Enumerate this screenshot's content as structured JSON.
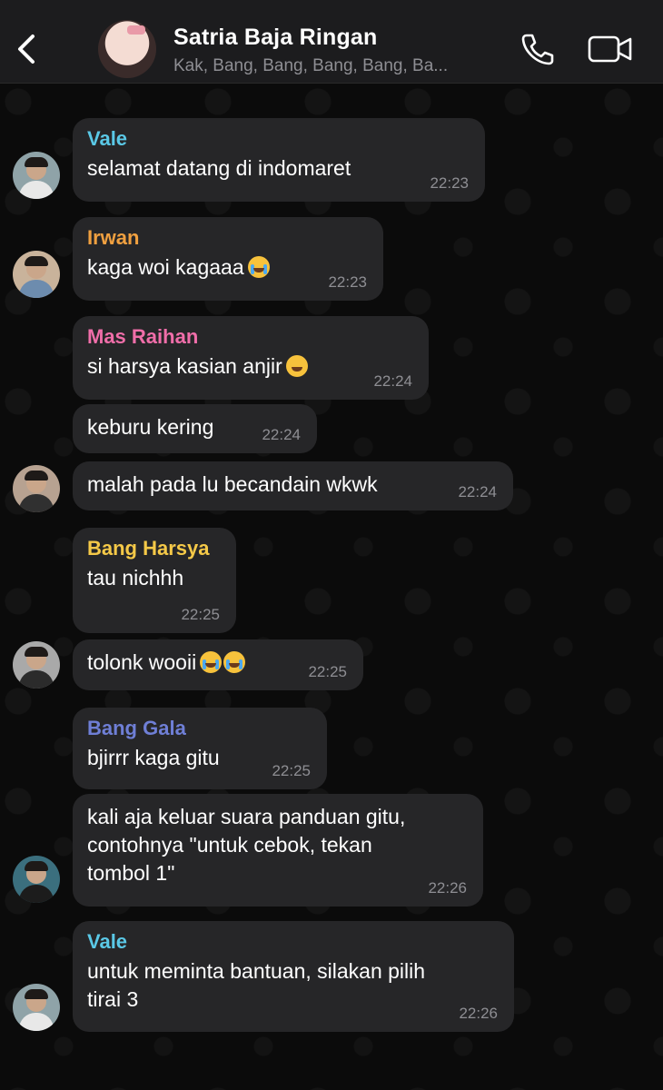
{
  "header": {
    "title": "Satria Baja Ringan",
    "members": "Kak, Bang, Bang, Bang, Bang, Ba...",
    "icons": [
      "back-chevron-icon",
      "phone-icon",
      "video-camera-icon"
    ]
  },
  "messages": [
    {
      "sender": "Vale",
      "sender_color": "#5ac8e6",
      "text": "selamat datang di indomaret",
      "time": "22:23"
    },
    {
      "sender": "Irwan",
      "sender_color": "#f0a040",
      "text": "kaga woi kagaaa",
      "time": "22:23"
    },
    {
      "sender": "Mas Raihan",
      "sender_color": "#f06ea9",
      "text": "si harsya kasian anjir",
      "time": "22:24"
    },
    {
      "sender": "",
      "text": "keburu kering",
      "time": "22:24"
    },
    {
      "sender": "",
      "text": "malah pada lu becandain wkwk",
      "time": "22:24"
    },
    {
      "sender": "Bang Harsya",
      "sender_color": "#f5c948",
      "text": "tau nichhh",
      "time": "22:25"
    },
    {
      "sender": "",
      "text": "tolonk wooii",
      "time": "22:25"
    },
    {
      "sender": "Bang Gala",
      "sender_color": "#6f7fd6",
      "text": "bjirrr kaga gitu",
      "time": "22:25"
    },
    {
      "sender": "",
      "text_lines": [
        "kali aja keluar suara panduan gitu,",
        "contohnya \"untuk cebok, tekan",
        "tombol 1\""
      ],
      "time": "22:26"
    },
    {
      "sender": "Vale",
      "sender_color": "#5ac8e6",
      "text_lines": [
        "untuk meminta bantuan, silakan pilih",
        "tirai 3"
      ],
      "time": "22:26"
    }
  ]
}
